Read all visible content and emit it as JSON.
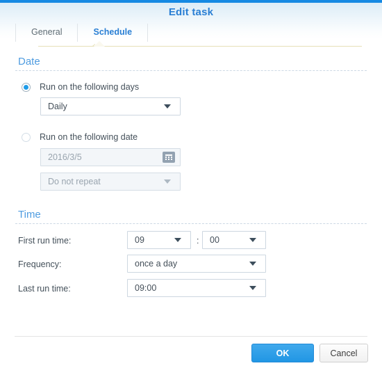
{
  "window": {
    "title": "Edit task"
  },
  "tabs": [
    {
      "label": "General",
      "active": false
    },
    {
      "label": "Schedule",
      "active": true
    }
  ],
  "sections": {
    "date": {
      "title": "Date",
      "option_days": {
        "label": "Run on the following days",
        "selected": true,
        "dropdown_value": "Daily"
      },
      "option_date": {
        "label": "Run on the following date",
        "selected": false,
        "date_value": "2016/3/5",
        "repeat_value": "Do not repeat",
        "calendar_icon": "calendar-icon"
      }
    },
    "time": {
      "title": "Time",
      "first_run": {
        "label": "First run time:",
        "hour": "09",
        "separator": ":",
        "minute": "00"
      },
      "frequency": {
        "label": "Frequency:",
        "value": "once a day"
      },
      "last_run": {
        "label": "Last run time:",
        "value": "09:00"
      }
    }
  },
  "footer": {
    "ok_label": "OK",
    "cancel_label": "Cancel"
  },
  "colors": {
    "accent_blue": "#1589e3",
    "title_blue": "#2a7fd4",
    "section_blue": "#4f9ce0",
    "radio_blue": "#1e9be8",
    "tab_underline": "#e6e0b8"
  }
}
